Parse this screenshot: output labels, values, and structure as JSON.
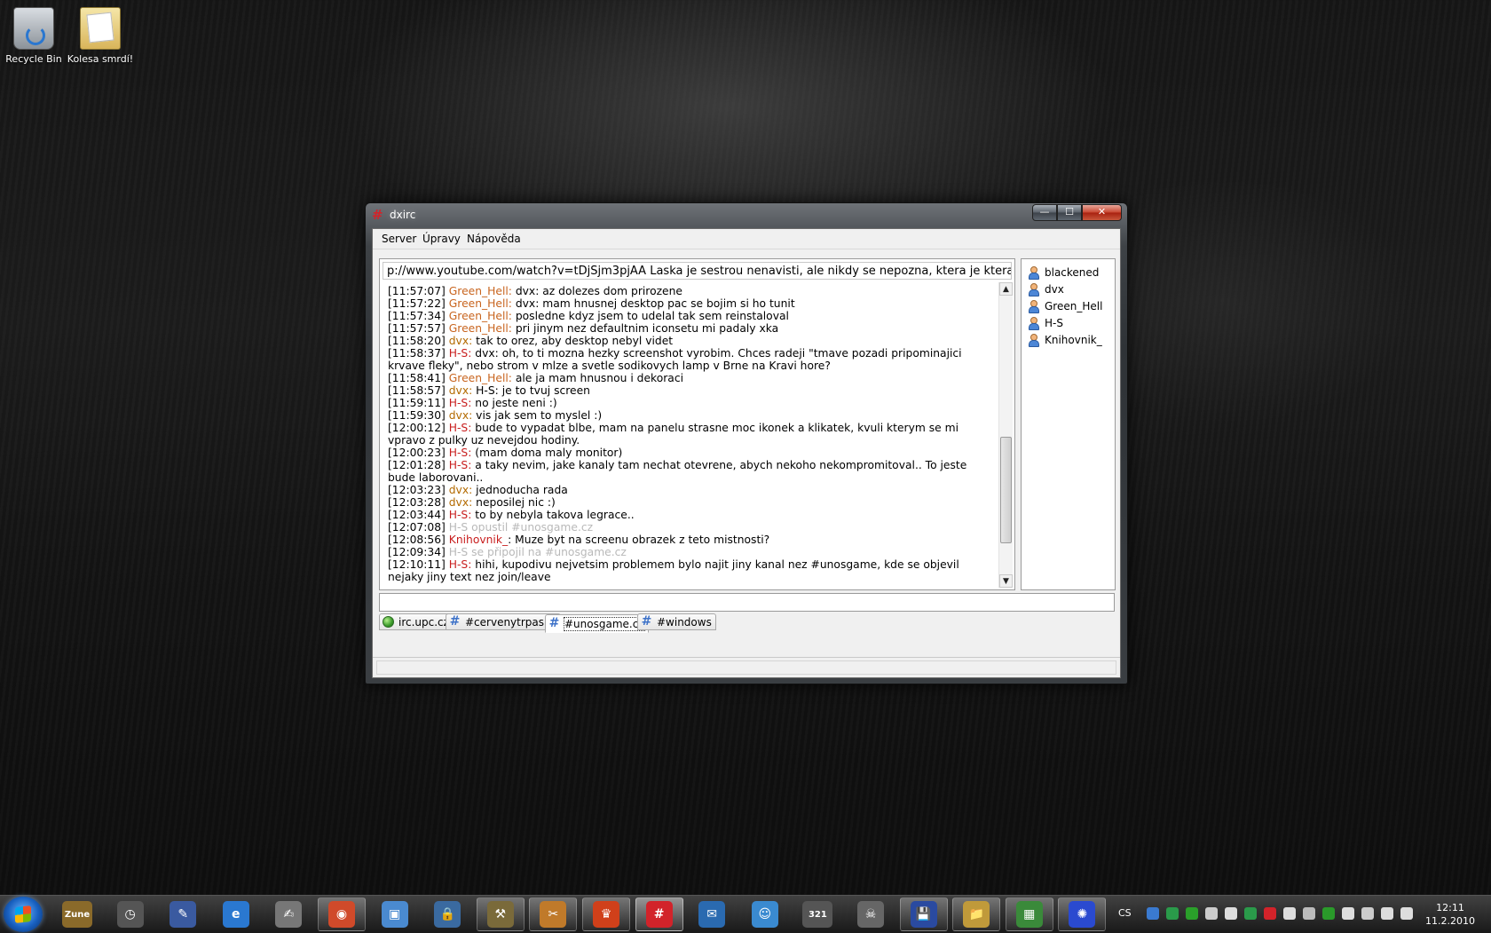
{
  "desktop": {
    "icons": [
      {
        "label": "Recycle Bin"
      },
      {
        "label": "Kolesa smrdí!"
      }
    ]
  },
  "window": {
    "title": "dxirc",
    "controls": {
      "minimize": "—",
      "maximize": "☐",
      "close": "✕"
    },
    "menu": [
      "Server",
      "Úpravy",
      "Nápověda"
    ],
    "topic": "p://www.youtube.com/watch?v=tDjSjm3pjAA Laska je sestrou nenavisti, ale nikdy se nepozna, ktera je ktera.",
    "log": [
      {
        "time": "[11:57:07]",
        "nick": "Green_Hell:",
        "nick_color": "#c8641e",
        "text": " dvx: az dolezes dom prirozene"
      },
      {
        "time": "[11:57:22]",
        "nick": "Green_Hell:",
        "nick_color": "#c8641e",
        "text": " dvx: mam hnusnej desktop pac se bojim si ho tunit"
      },
      {
        "time": "[11:57:34]",
        "nick": "Green_Hell:",
        "nick_color": "#c8641e",
        "text": " posledne kdyz jsem to udelal tak sem reinstaloval"
      },
      {
        "time": "[11:57:57]",
        "nick": "Green_Hell:",
        "nick_color": "#c8641e",
        "text": " pri jinym nez defaultnim iconsetu mi padaly xka"
      },
      {
        "time": "[11:58:20]",
        "nick": "dvx:",
        "nick_color": "#b36a00",
        "text": " tak to orez, aby desktop nebyl videt"
      },
      {
        "time": "[11:58:37]",
        "nick": "H-S:",
        "nick_color": "#c81e1e",
        "text": " dvx: oh, to ti mozna hezky screenshot vyrobim. Chces radeji \"tmave pozadi pripominajici krvave fleky\", nebo strom v mlze a svetle sodikovych lamp v Brne na Kravi hore?"
      },
      {
        "time": "[11:58:41]",
        "nick": "Green_Hell:",
        "nick_color": "#c8641e",
        "text": " ale ja mam hnusnou i dekoraci"
      },
      {
        "time": "[11:58:57]",
        "nick": "dvx:",
        "nick_color": "#b36a00",
        "text": " H-S: je to tvuj screen"
      },
      {
        "time": "[11:59:11]",
        "nick": "H-S:",
        "nick_color": "#c81e1e",
        "text": " no jeste neni :)"
      },
      {
        "time": "[11:59:30]",
        "nick": "dvx:",
        "nick_color": "#b36a00",
        "text": " vis jak sem to myslel :)"
      },
      {
        "time": "[12:00:12]",
        "nick": "H-S:",
        "nick_color": "#c81e1e",
        "text": " bude to vypadat blbe, mam na panelu strasne moc ikonek a klikatek, kvuli kterym se mi vpravo z pulky uz nevejdou hodiny."
      },
      {
        "time": "[12:00:23]",
        "nick": "H-S:",
        "nick_color": "#c81e1e",
        "text": " (mam doma maly monitor)"
      },
      {
        "time": "[12:01:28]",
        "nick": "H-S:",
        "nick_color": "#c81e1e",
        "text": " a taky nevim, jake kanaly tam nechat otevrene, abych nekoho nekompromitoval.. To jeste bude laborovani.."
      },
      {
        "time": "[12:03:23]",
        "nick": "dvx:",
        "nick_color": "#b36a00",
        "text": " jednoducha rada"
      },
      {
        "time": "[12:03:28]",
        "nick": "dvx:",
        "nick_color": "#b36a00",
        "text": " neposilej nic :)"
      },
      {
        "time": "[12:03:44]",
        "nick": "H-S:",
        "nick_color": "#c81e1e",
        "text": " to by nebyla takova legrace.."
      },
      {
        "time": "[12:07:08]",
        "nick": "H-S opustil #unosgame.cz",
        "nick_color": "#b9b9b9",
        "text": ""
      },
      {
        "time": "[12:08:56]",
        "nick": "Knihovnik_",
        "nick_color": "#c81e1e",
        "text": ": Muze byt na screenu obrazek z teto mistnosti?"
      },
      {
        "time": "[12:09:34]",
        "nick": "H-S se připojil na #unosgame.cz",
        "nick_color": "#b9b9b9",
        "text": ""
      },
      {
        "time": "[12:10:11]",
        "nick": "H-S:",
        "nick_color": "#c81e1e",
        "text": " hihi, kupodivu nejvetsim problemem bylo najit jiny kanal nez #unosgame, kde se objevil nejaky jiny text nez join/leave"
      }
    ],
    "scrollbar": {
      "up": "▲",
      "down": "▼",
      "position": 0.82
    },
    "users": [
      "blackened",
      "dvx",
      "Green_Hell",
      "H-S",
      "Knihovnik_"
    ],
    "input_value": "",
    "tabs": [
      {
        "label": "irc.upc.cz",
        "icon": "globe-icon",
        "active": false
      },
      {
        "label": "#cervenytrpaslik",
        "icon": "channel-icon",
        "active": false
      },
      {
        "label": "#unosgame.cz",
        "icon": "channel-icon",
        "active": true
      },
      {
        "label": "#windows",
        "icon": "channel-icon",
        "active": false
      }
    ],
    "status": ""
  },
  "taskbar": {
    "apps": [
      {
        "name": "zune-icon",
        "glyph": "Zune",
        "color": "#8a6a2a"
      },
      {
        "name": "clock-gadget-icon",
        "glyph": "◷",
        "color": "#555555"
      },
      {
        "name": "document-icon",
        "glyph": "✎",
        "color": "#3a5aa0"
      },
      {
        "name": "internet-explorer-icon",
        "glyph": "e",
        "color": "#2a78d0"
      },
      {
        "name": "notepad-icon",
        "glyph": "✍",
        "color": "#777777"
      },
      {
        "name": "chrome-icon",
        "glyph": "◉",
        "color": "#d04a2a"
      },
      {
        "name": "box-icon",
        "glyph": "▣",
        "color": "#4a8ad0"
      },
      {
        "name": "lock-icon",
        "glyph": "🔒",
        "color": "#3a6aa0"
      },
      {
        "name": "tools-icon",
        "glyph": "⚒",
        "color": "#7a6a3a"
      },
      {
        "name": "settings-icon",
        "glyph": "✂",
        "color": "#c07a2a"
      },
      {
        "name": "crown-icon",
        "glyph": "♛",
        "color": "#d0401a"
      },
      {
        "name": "dxirc-icon",
        "glyph": "#",
        "color": "#d2232a"
      },
      {
        "name": "mail-icon",
        "glyph": "✉",
        "color": "#2a6ab0"
      },
      {
        "name": "messenger-icon",
        "glyph": "☺",
        "color": "#3a8ad0"
      },
      {
        "name": "media-icon",
        "glyph": "321",
        "color": "#555555"
      },
      {
        "name": "alien-icon",
        "glyph": "☠",
        "color": "#666666"
      },
      {
        "name": "save-icon",
        "glyph": "💾",
        "color": "#2a4aa0"
      },
      {
        "name": "explorer-icon",
        "glyph": "📁",
        "color": "#c09a3a"
      },
      {
        "name": "spreadsheet-icon",
        "glyph": "▦",
        "color": "#3a8a3a"
      },
      {
        "name": "orbit-icon",
        "glyph": "✺",
        "color": "#2a4ad0"
      }
    ],
    "open_apps": [
      5,
      8,
      9,
      10,
      11,
      16,
      17,
      18,
      19
    ],
    "active_app": 11,
    "language": "CS",
    "tray_colors": [
      "#3a7ad0",
      "#2a9a4a",
      "#2aa02a",
      "#cccccc",
      "#dddddd",
      "#2a9a4a",
      "#d2232a",
      "#dddddd",
      "#bbbbbb",
      "#2a9a2a",
      "#dddddd",
      "#cccccc",
      "#dddddd",
      "#dddddd"
    ],
    "time": "12:11",
    "date": "11.2.2010"
  }
}
